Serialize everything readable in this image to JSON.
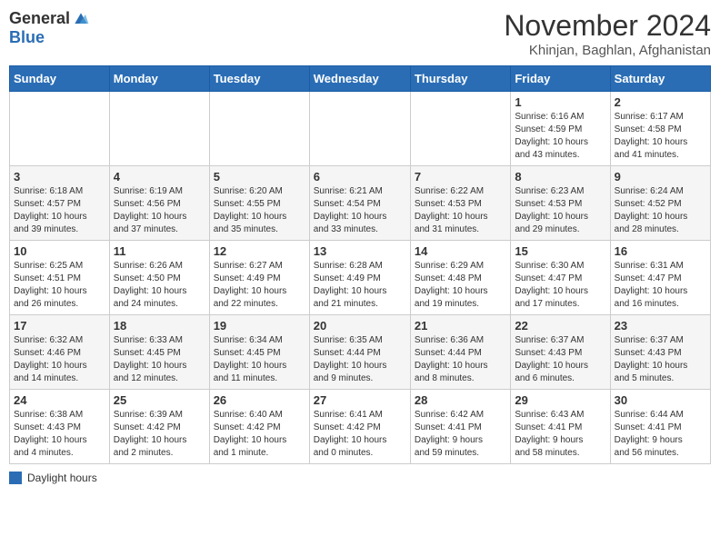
{
  "header": {
    "logo_general": "General",
    "logo_blue": "Blue",
    "month_title": "November 2024",
    "location": "Khinjan, Baghlan, Afghanistan"
  },
  "weekdays": [
    "Sunday",
    "Monday",
    "Tuesday",
    "Wednesday",
    "Thursday",
    "Friday",
    "Saturday"
  ],
  "weeks": [
    [
      {
        "day": "",
        "info": ""
      },
      {
        "day": "",
        "info": ""
      },
      {
        "day": "",
        "info": ""
      },
      {
        "day": "",
        "info": ""
      },
      {
        "day": "",
        "info": ""
      },
      {
        "day": "1",
        "info": "Sunrise: 6:16 AM\nSunset: 4:59 PM\nDaylight: 10 hours\nand 43 minutes."
      },
      {
        "day": "2",
        "info": "Sunrise: 6:17 AM\nSunset: 4:58 PM\nDaylight: 10 hours\nand 41 minutes."
      }
    ],
    [
      {
        "day": "3",
        "info": "Sunrise: 6:18 AM\nSunset: 4:57 PM\nDaylight: 10 hours\nand 39 minutes."
      },
      {
        "day": "4",
        "info": "Sunrise: 6:19 AM\nSunset: 4:56 PM\nDaylight: 10 hours\nand 37 minutes."
      },
      {
        "day": "5",
        "info": "Sunrise: 6:20 AM\nSunset: 4:55 PM\nDaylight: 10 hours\nand 35 minutes."
      },
      {
        "day": "6",
        "info": "Sunrise: 6:21 AM\nSunset: 4:54 PM\nDaylight: 10 hours\nand 33 minutes."
      },
      {
        "day": "7",
        "info": "Sunrise: 6:22 AM\nSunset: 4:53 PM\nDaylight: 10 hours\nand 31 minutes."
      },
      {
        "day": "8",
        "info": "Sunrise: 6:23 AM\nSunset: 4:53 PM\nDaylight: 10 hours\nand 29 minutes."
      },
      {
        "day": "9",
        "info": "Sunrise: 6:24 AM\nSunset: 4:52 PM\nDaylight: 10 hours\nand 28 minutes."
      }
    ],
    [
      {
        "day": "10",
        "info": "Sunrise: 6:25 AM\nSunset: 4:51 PM\nDaylight: 10 hours\nand 26 minutes."
      },
      {
        "day": "11",
        "info": "Sunrise: 6:26 AM\nSunset: 4:50 PM\nDaylight: 10 hours\nand 24 minutes."
      },
      {
        "day": "12",
        "info": "Sunrise: 6:27 AM\nSunset: 4:49 PM\nDaylight: 10 hours\nand 22 minutes."
      },
      {
        "day": "13",
        "info": "Sunrise: 6:28 AM\nSunset: 4:49 PM\nDaylight: 10 hours\nand 21 minutes."
      },
      {
        "day": "14",
        "info": "Sunrise: 6:29 AM\nSunset: 4:48 PM\nDaylight: 10 hours\nand 19 minutes."
      },
      {
        "day": "15",
        "info": "Sunrise: 6:30 AM\nSunset: 4:47 PM\nDaylight: 10 hours\nand 17 minutes."
      },
      {
        "day": "16",
        "info": "Sunrise: 6:31 AM\nSunset: 4:47 PM\nDaylight: 10 hours\nand 16 minutes."
      }
    ],
    [
      {
        "day": "17",
        "info": "Sunrise: 6:32 AM\nSunset: 4:46 PM\nDaylight: 10 hours\nand 14 minutes."
      },
      {
        "day": "18",
        "info": "Sunrise: 6:33 AM\nSunset: 4:45 PM\nDaylight: 10 hours\nand 12 minutes."
      },
      {
        "day": "19",
        "info": "Sunrise: 6:34 AM\nSunset: 4:45 PM\nDaylight: 10 hours\nand 11 minutes."
      },
      {
        "day": "20",
        "info": "Sunrise: 6:35 AM\nSunset: 4:44 PM\nDaylight: 10 hours\nand 9 minutes."
      },
      {
        "day": "21",
        "info": "Sunrise: 6:36 AM\nSunset: 4:44 PM\nDaylight: 10 hours\nand 8 minutes."
      },
      {
        "day": "22",
        "info": "Sunrise: 6:37 AM\nSunset: 4:43 PM\nDaylight: 10 hours\nand 6 minutes."
      },
      {
        "day": "23",
        "info": "Sunrise: 6:37 AM\nSunset: 4:43 PM\nDaylight: 10 hours\nand 5 minutes."
      }
    ],
    [
      {
        "day": "24",
        "info": "Sunrise: 6:38 AM\nSunset: 4:43 PM\nDaylight: 10 hours\nand 4 minutes."
      },
      {
        "day": "25",
        "info": "Sunrise: 6:39 AM\nSunset: 4:42 PM\nDaylight: 10 hours\nand 2 minutes."
      },
      {
        "day": "26",
        "info": "Sunrise: 6:40 AM\nSunset: 4:42 PM\nDaylight: 10 hours\nand 1 minute."
      },
      {
        "day": "27",
        "info": "Sunrise: 6:41 AM\nSunset: 4:42 PM\nDaylight: 10 hours\nand 0 minutes."
      },
      {
        "day": "28",
        "info": "Sunrise: 6:42 AM\nSunset: 4:41 PM\nDaylight: 9 hours\nand 59 minutes."
      },
      {
        "day": "29",
        "info": "Sunrise: 6:43 AM\nSunset: 4:41 PM\nDaylight: 9 hours\nand 58 minutes."
      },
      {
        "day": "30",
        "info": "Sunrise: 6:44 AM\nSunset: 4:41 PM\nDaylight: 9 hours\nand 56 minutes."
      }
    ]
  ],
  "footer": {
    "legend_label": "Daylight hours"
  }
}
